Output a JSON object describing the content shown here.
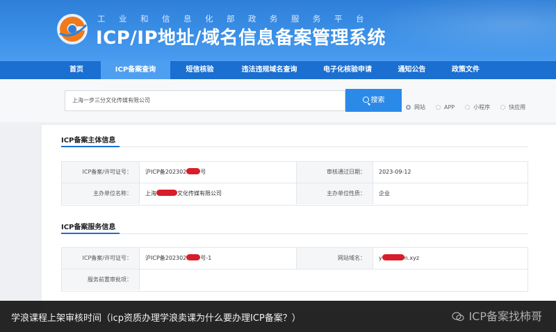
{
  "header": {
    "subtitle": "工业和信息化部政务服务平台",
    "title": "ICP/IP地址/域名信息备案管理系统"
  },
  "nav": {
    "items": [
      {
        "label": "首页"
      },
      {
        "label": "ICP备案查询"
      },
      {
        "label": "短信核验"
      },
      {
        "label": "违法违规域名查询"
      },
      {
        "label": "电子化核验申请"
      },
      {
        "label": "通知公告"
      },
      {
        "label": "政策文件"
      }
    ],
    "active": "ICP备案查询"
  },
  "search": {
    "value": "上海一步三分文化传媒有限公司",
    "button": "搜索",
    "options": [
      {
        "label": "网站",
        "selected": true
      },
      {
        "label": "APP",
        "selected": false
      },
      {
        "label": "小程序",
        "selected": false
      },
      {
        "label": "快应用",
        "selected": false
      }
    ]
  },
  "subject_info": {
    "title": "ICP备案主体信息",
    "license_label": "ICP备案/许可证号：",
    "license_value_prefix": "沪ICP备202302",
    "license_value_suffix": "号",
    "approve_date_label": "审核通过日期：",
    "approve_date": "2023-09-12",
    "org_label": "主办单位名称：",
    "org_prefix": "上海",
    "org_suffix": "文化传媒有限公司",
    "org_type_label": "主办单位性质：",
    "org_type": "企业"
  },
  "service_info": {
    "title": "ICP备案服务信息",
    "license_label": "ICP备案/许可证号：",
    "license_value_prefix": "沪ICP备202302",
    "license_value_suffix": "号-1",
    "domain_label": "网站域名：",
    "domain_prefix": "y",
    "domain_suffix": "n.xyz",
    "pre_approval_label": "服务前置审批项："
  },
  "caption": {
    "text": "学浪课程上架审核时间（icp资质办理学浪卖课为什么要办理ICP备案？）",
    "watermark": "ICP备案找柿哥"
  },
  "colors": {
    "brand_blue": "#1a6fd0",
    "nav_active": "#4f9ff0",
    "search_button": "#2b8ae8",
    "redaction": "#d81e2a"
  }
}
